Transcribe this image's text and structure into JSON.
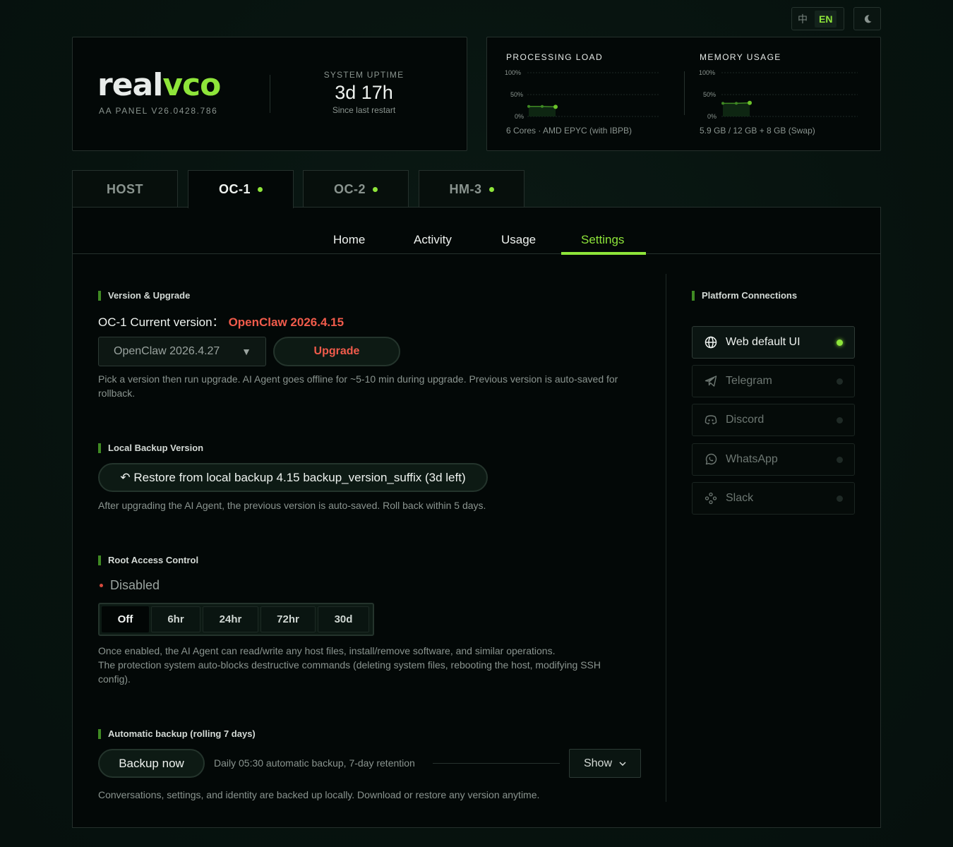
{
  "topbar": {
    "lang_zh": "中",
    "lang_en": "EN"
  },
  "brand": {
    "logo_part1": "real",
    "logo_part2": "vco",
    "panel_version": "AA PANEL  V26.0428.786"
  },
  "uptime": {
    "label": "SYSTEM UPTIME",
    "value": "3d 17h",
    "sub": "Since last restart"
  },
  "stats": {
    "processing": {
      "title": "PROCESSING LOAD",
      "ticks": [
        "100%",
        "50%",
        "0%"
      ],
      "footer": "6 Cores · AMD EPYC (with IBPB)"
    },
    "memory": {
      "title": "MEMORY USAGE",
      "ticks": [
        "100%",
        "50%",
        "0%"
      ],
      "footer": "5.9 GB / 12 GB + 8 GB (Swap)"
    }
  },
  "chart_data": [
    {
      "type": "line",
      "title": "PROCESSING LOAD",
      "ylim": [
        0,
        100
      ],
      "yticks": [
        "0%",
        "50%",
        "100%"
      ],
      "x": [
        1,
        2,
        3
      ],
      "values": [
        23,
        23,
        22
      ]
    },
    {
      "type": "line",
      "title": "MEMORY USAGE",
      "ylim": [
        0,
        100
      ],
      "yticks": [
        "0%",
        "50%",
        "100%"
      ],
      "x": [
        1,
        2,
        3
      ],
      "values": [
        30,
        30,
        31
      ]
    }
  ],
  "instance_tabs": [
    {
      "label": "HOST",
      "status": false
    },
    {
      "label": "OC-1",
      "status": true
    },
    {
      "label": "OC-2",
      "status": true
    },
    {
      "label": "HM-3",
      "status": true
    }
  ],
  "subtabs": [
    "Home",
    "Activity",
    "Usage",
    "Settings"
  ],
  "version": {
    "title": "Version & Upgrade",
    "current_prefix": "OC-1 Current version：",
    "current_value": "OpenClaw 2026.4.15",
    "select_value": "OpenClaw 2026.4.27",
    "upgrade_label": "Upgrade",
    "help_line1": "Pick a version then run upgrade. AI Agent goes offline for ~5-10 min during upgrade. Previous version is auto-saved for",
    "help_line2": "rollback."
  },
  "backup_local": {
    "title": "Local Backup Version",
    "restore_label": "↶ Restore from local backup 4.15 backup_version_suffix (3d left)",
    "help": "After upgrading the AI Agent, the previous version is auto-saved. Roll back within 5 days."
  },
  "root_access": {
    "title": "Root Access Control",
    "status": "Disabled",
    "options": [
      "Off",
      "6hr",
      "24hr",
      "72hr",
      "30d"
    ],
    "selected": "Off",
    "help_line1": "Once enabled, the AI Agent can read/write any host files, install/remove software, and similar operations.",
    "help_line2": "The protection system auto-blocks destructive commands (deleting system files, rebooting the host, modifying SSH",
    "help_line3": "config)."
  },
  "auto_backup": {
    "title": "Automatic backup (rolling 7 days)",
    "button_label": "Backup now",
    "schedule": "Daily 05:30 automatic backup, 7-day retention",
    "show_label": "Show",
    "help": "Conversations, settings, and identity are backed up locally. Download or restore any version anytime."
  },
  "platforms": {
    "title": "Platform Connections",
    "items": [
      {
        "label": "Web default UI",
        "icon": "globe-icon",
        "connected": true
      },
      {
        "label": "Telegram",
        "icon": "telegram-icon",
        "connected": false
      },
      {
        "label": "Discord",
        "icon": "discord-icon",
        "connected": false
      },
      {
        "label": "WhatsApp",
        "icon": "whatsapp-icon",
        "connected": false
      },
      {
        "label": "Slack",
        "icon": "slack-icon",
        "connected": false
      }
    ]
  },
  "colors": {
    "accent": "#8ee53a",
    "danger": "#f05b4b",
    "background": "#07130f"
  }
}
